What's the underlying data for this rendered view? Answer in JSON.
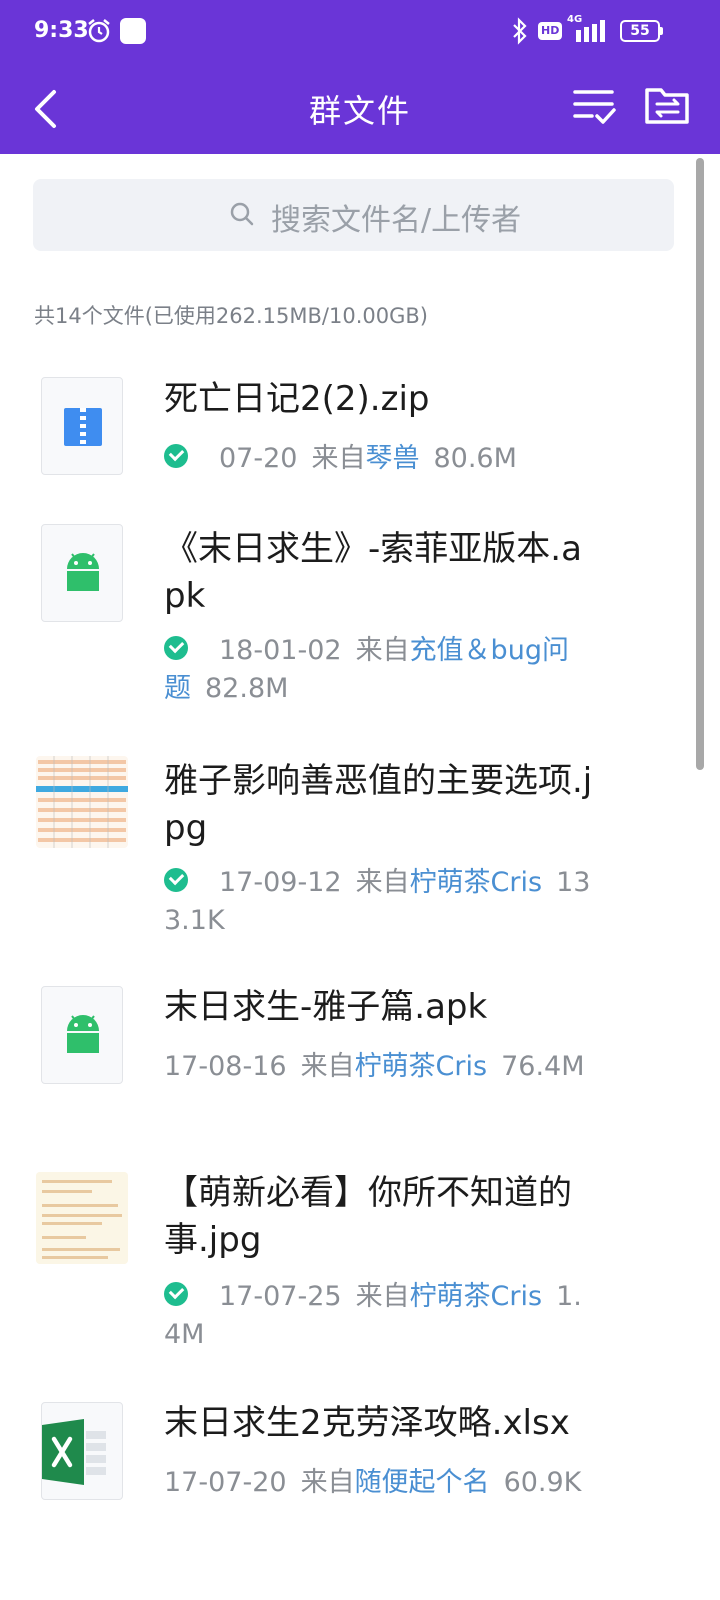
{
  "status": {
    "time": "9:33",
    "network": "4G",
    "hd": "HD",
    "battery": "55"
  },
  "header": {
    "title": "群文件"
  },
  "search": {
    "placeholder": "搜索文件名/上传者"
  },
  "summary": "共14个文件(已使用262.15MB/10.00GB)",
  "files": [
    {
      "name": "死亡日记2(2).zip",
      "date": "07-20",
      "from": "来自",
      "uploader": "琴兽",
      "size": "80.6M",
      "downloaded": true,
      "icon": "zip-icon"
    },
    {
      "name": "《末日求生》-索菲亚版本.apk",
      "date": "18-01-02",
      "from": "来自",
      "uploader": "充值＆bug问题",
      "size": "82.8M",
      "downloaded": true,
      "icon": "android-icon"
    },
    {
      "name": "雅子影响善恶值的主要选项.jpg",
      "date": "17-09-12",
      "from": "来自",
      "uploader": "柠萌茶Cris",
      "size": "133.1K",
      "downloaded": true,
      "icon": "image-thumbnail"
    },
    {
      "name": "末日求生-雅子篇.apk",
      "date": "17-08-16",
      "from": "来自",
      "uploader": "柠萌茶Cris",
      "size": "76.4M",
      "downloaded": false,
      "icon": "android-icon"
    },
    {
      "name": "【萌新必看】你所不知道的事.jpg",
      "date": "17-07-25",
      "from": "来自",
      "uploader": "柠萌茶Cris",
      "size": "1.4M",
      "downloaded": true,
      "icon": "image-thumbnail"
    },
    {
      "name": "末日求生2克劳泽攻略.xlsx",
      "date": "17-07-20",
      "from": "来自",
      "uploader": "随便起个名",
      "size": "60.9K",
      "downloaded": false,
      "icon": "excel-icon"
    }
  ],
  "colors": {
    "brand": "#6a35d7",
    "link": "#4a8fd2",
    "check": "#1ebd8f"
  }
}
